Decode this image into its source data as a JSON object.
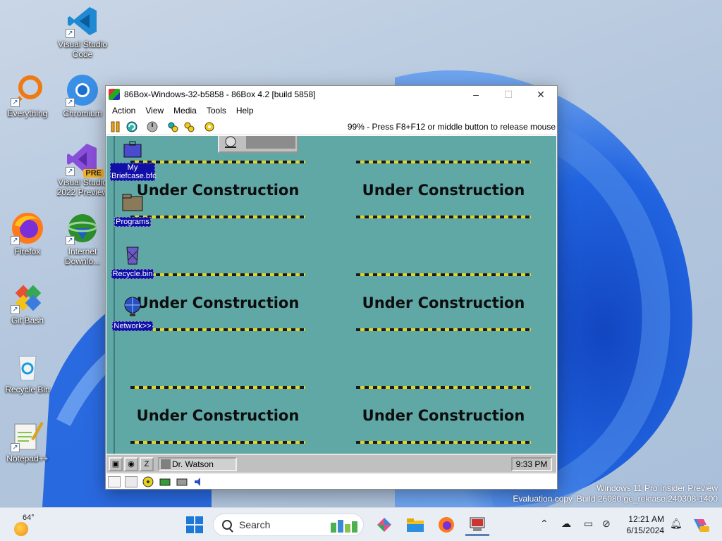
{
  "desktop": {
    "icons": [
      {
        "label": "Visual Studio Code"
      },
      {
        "label": "Everything"
      },
      {
        "label": "Chromium"
      },
      {
        "label": "Visual Studio 2022 Preview"
      },
      {
        "label": "Firefox"
      },
      {
        "label": "Internet Downlo..."
      },
      {
        "label": "Git Bash"
      },
      {
        "label": "Recycle Bin"
      },
      {
        "label": "Notepad++"
      }
    ],
    "vs_badge": "PRE"
  },
  "window": {
    "title": "86Box-Windows-32-b5858 - 86Box 4.2 [build 5858]",
    "minimize": "–",
    "maximize": "☐",
    "close": "✕",
    "menu": [
      "Action",
      "View",
      "Media",
      "Tools",
      "Help"
    ],
    "toolbar_status": "99% - Press F8+F12 or middle button to release mouse"
  },
  "guest": {
    "icons": [
      {
        "label": "My Briefcase.bfc"
      },
      {
        "label": "Programs"
      },
      {
        "label": "Recycle.bin"
      },
      {
        "label": "Network>>"
      }
    ],
    "banner_text": "Under Construction",
    "taskbar_item": "Dr. Watson",
    "clock": "9:33 PM"
  },
  "watermark": {
    "line1": "Windows 11 Pro Insider Preview",
    "line2": "Evaluation copy. Build 26080.ge_release.240308-1400"
  },
  "taskbar": {
    "temperature": "64°",
    "search_label": "Search",
    "time": "12:21 AM",
    "date": "6/15/2024"
  }
}
